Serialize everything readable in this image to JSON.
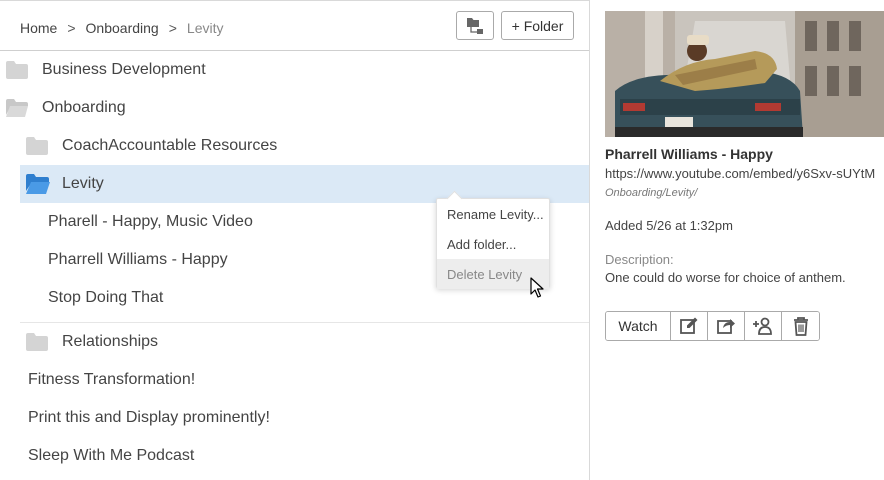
{
  "breadcrumb": {
    "items": [
      "Home",
      "Onboarding",
      "Levity"
    ],
    "separator": ">"
  },
  "toolbar": {
    "add_folder_label": "+ Folder",
    "tree_icon": "folder-tree-icon"
  },
  "tree": {
    "folders_top": [
      {
        "label": "Business Development",
        "icon": "folder-icon"
      },
      {
        "label": "Onboarding",
        "icon": "folder-open-icon"
      }
    ],
    "sub_folders": [
      {
        "label": "CoachAccountable Resources",
        "icon": "folder-icon"
      },
      {
        "label": "Levity",
        "icon": "folder-open-icon",
        "selected": true
      }
    ],
    "levity_items": [
      "Pharell - Happy, Music Video",
      "Pharrell Williams - Happy",
      "Stop Doing That"
    ],
    "after": {
      "label": "Relationships",
      "icon": "folder-icon"
    },
    "root_items": [
      "Fitness Transformation!",
      "Print this and Display prominently!",
      "Sleep With Me Podcast"
    ]
  },
  "context_menu": {
    "items": [
      "Rename Levity...",
      "Add folder...",
      "Delete Levity"
    ],
    "hovered": "Delete Levity"
  },
  "detail": {
    "title": "Pharrell Williams - Happy",
    "url": "https://www.youtube.com/embed/y6Sxv-sUYtM",
    "path": "Onboarding/Levity/",
    "added": "Added 5/26 at 1:32pm",
    "description_label": "Description:",
    "description": "One could do worse for choice of anthem.",
    "actions": {
      "watch": "Watch",
      "icons": [
        "edit-icon",
        "share-icon",
        "add-user-icon",
        "trash-icon"
      ]
    }
  },
  "colors": {
    "accent": "#3b8fd9",
    "selection": "#dbe9f6",
    "folder_grey": "#d4d4d4"
  }
}
